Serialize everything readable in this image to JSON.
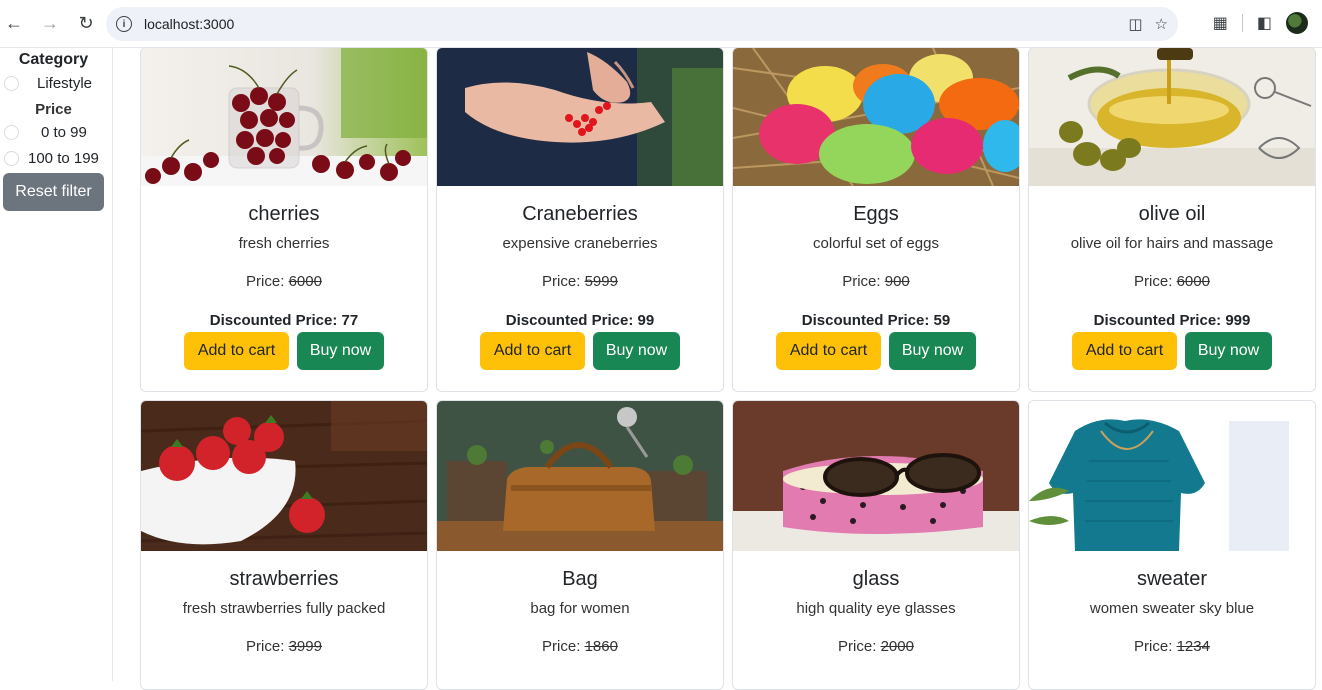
{
  "browser": {
    "url": "localhost:3000",
    "back_icon": "arrow-left-icon",
    "forward_icon": "arrow-right-icon",
    "reload_icon": "reload-icon"
  },
  "sidebar": {
    "category_heading": "Category",
    "category_options": [
      "Lifestyle"
    ],
    "price_heading": "Price",
    "price_options": [
      "0 to 99",
      "100 to 199"
    ],
    "reset_label": "Reset filter"
  },
  "labels": {
    "price_prefix": "Price:",
    "discount_prefix": "Discounted Price:",
    "add_to_cart": "Add to cart",
    "buy_now": "Buy now"
  },
  "products": [
    {
      "title": "cherries",
      "description": "fresh cherries",
      "price": "6000",
      "discounted": "77"
    },
    {
      "title": "Craneberries",
      "description": "expensive craneberries",
      "price": "5999",
      "discounted": "99"
    },
    {
      "title": "Eggs",
      "description": "colorful set of eggs",
      "price": "900",
      "discounted": "59"
    },
    {
      "title": "olive oil",
      "description": "olive oil for hairs and massage",
      "price": "6000",
      "discounted": "999"
    },
    {
      "title": "strawberries",
      "description": "fresh strawberries fully packed",
      "price": "3999"
    },
    {
      "title": "Bag",
      "description": "bag for women",
      "price": "1860"
    },
    {
      "title": "glass",
      "description": "high quality eye glasses",
      "price": "2000"
    },
    {
      "title": "sweater",
      "description": "women sweater sky blue",
      "price": "1234"
    }
  ],
  "colors": {
    "cart_button": "#ffc107",
    "buy_button": "#198754",
    "reset_button": "#6c757d"
  }
}
